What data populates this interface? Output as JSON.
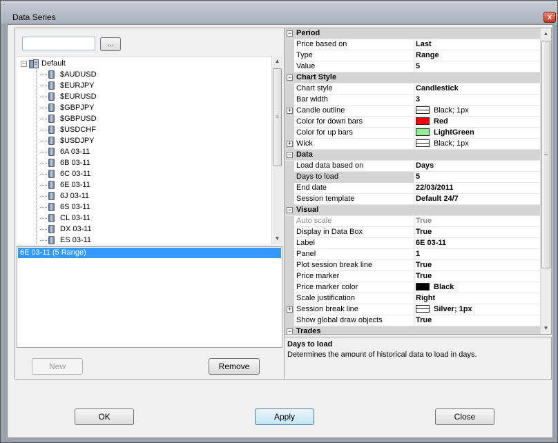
{
  "window": {
    "title": "Data Series",
    "close_glyph": "x"
  },
  "search": {
    "value": "",
    "browse_label": "..."
  },
  "tree": {
    "root": "Default",
    "items": [
      "$AUDUSD",
      "$EURJPY",
      "$EURUSD",
      "$GBPJPY",
      "$GBPUSD",
      "$USDCHF",
      "$USDJPY",
      "6A 03-11",
      "6B 03-11",
      "6C 03-11",
      "6E 03-11",
      "6J 03-11",
      "6S 03-11",
      "CL 03-11",
      "DX 03-11",
      "ES 03-11"
    ]
  },
  "series_list": {
    "items": [
      "6E 03-11 (5 Range)"
    ]
  },
  "left_buttons": {
    "new": "New",
    "remove": "Remove"
  },
  "properties": {
    "period": {
      "title": "Period",
      "rows": [
        {
          "name": "Price based on",
          "value": "Last"
        },
        {
          "name": "Type",
          "value": "Range"
        },
        {
          "name": "Value",
          "value": "5"
        }
      ]
    },
    "chart_style": {
      "title": "Chart Style",
      "rows": [
        {
          "name": "Chart style",
          "value": "Candlestick"
        },
        {
          "name": "Bar width",
          "value": "3"
        },
        {
          "name": "Candle outline",
          "value": "Black; 1px"
        },
        {
          "name": "Color for down bars",
          "value": "Red"
        },
        {
          "name": "Color for up bars",
          "value": "LightGreen"
        },
        {
          "name": "Wick",
          "value": "Black; 1px"
        }
      ]
    },
    "data": {
      "title": "Data",
      "rows": [
        {
          "name": "Load data based on",
          "value": "Days"
        },
        {
          "name": "Days to load",
          "value": "5"
        },
        {
          "name": "End date",
          "value": "22/03/2011"
        },
        {
          "name": "Session template",
          "value": "Default 24/7"
        }
      ]
    },
    "visual": {
      "title": "Visual",
      "rows": [
        {
          "name": "Auto scale",
          "value": "True"
        },
        {
          "name": "Display in Data Box",
          "value": "True"
        },
        {
          "name": "Label",
          "value": "6E 03-11"
        },
        {
          "name": "Panel",
          "value": "1"
        },
        {
          "name": "Plot session break line",
          "value": "True"
        },
        {
          "name": "Price marker",
          "value": "True"
        },
        {
          "name": "Price marker color",
          "value": "Black"
        },
        {
          "name": "Scale justification",
          "value": "Right"
        },
        {
          "name": "Session break line",
          "value": "Silver; 1px"
        },
        {
          "name": "Show global draw objects",
          "value": "True"
        }
      ]
    },
    "trades": {
      "title": "Trades"
    }
  },
  "colors": {
    "down_bars": "#ff0000",
    "up_bars": "#90ee90",
    "price_marker": "#000000",
    "selection": "#3399ff"
  },
  "help": {
    "title": "Days to load",
    "description": "Determines the amount of historical data to load in days."
  },
  "footer": {
    "ok": "OK",
    "apply": "Apply",
    "close": "Close"
  }
}
